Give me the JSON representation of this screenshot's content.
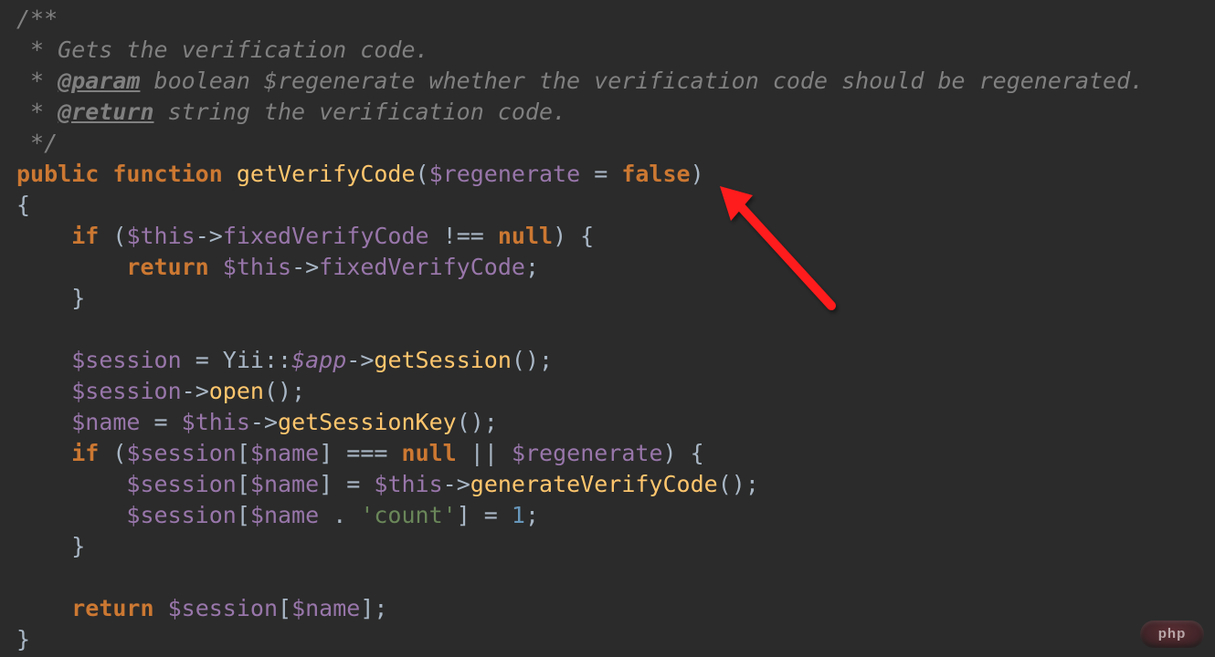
{
  "doc": {
    "open": "/**",
    "line1_prefix": " * ",
    "line1_text": "Gets the verification code.",
    "line2_prefix": " * ",
    "line2_tag": "@param",
    "line2_text": " boolean $regenerate whether the verification code should be regenerated.",
    "line3_prefix": " * ",
    "line3_tag": "@return",
    "line3_text": " string the verification code.",
    "close": " */"
  },
  "sig": {
    "kw_public": "public",
    "kw_function": "function",
    "name": "getVerifyCode",
    "paren_open": "(",
    "param": "$regenerate",
    "eq": " = ",
    "default": "false",
    "paren_close": ")"
  },
  "body": {
    "brace_open": "{",
    "if1": {
      "kw_if": "if",
      "po": " (",
      "this": "$this",
      "arrow": "->",
      "prop": "fixedVerifyCode",
      "neq": " !== ",
      "null": "null",
      "pc": ") {"
    },
    "ret1": {
      "kw_return": "return",
      "sp": " ",
      "this": "$this",
      "arrow": "->",
      "prop": "fixedVerifyCode",
      "semi": ";"
    },
    "close1": "}",
    "sess_assign": {
      "var": "$session",
      "eq": " = ",
      "cls": "Yii",
      "dcolon": "::",
      "static": "$app",
      "arrow": "->",
      "call": "getSession",
      "parens": "()",
      "semi": ";"
    },
    "sess_open": {
      "var": "$session",
      "arrow": "->",
      "call": "open",
      "parens": "()",
      "semi": ";"
    },
    "name_assign": {
      "var": "$name",
      "eq": " = ",
      "this": "$this",
      "arrow": "->",
      "call": "getSessionKey",
      "parens": "()",
      "semi": ";"
    },
    "if2": {
      "kw_if": "if",
      "po": " (",
      "sess": "$session",
      "br_o": "[",
      "nm": "$name",
      "br_c": "]",
      "eqeqeq": " === ",
      "null": "null",
      "oror": " || ",
      "regen": "$regenerate",
      "pc": ") {"
    },
    "gen": {
      "sess": "$session",
      "br_o": "[",
      "nm": "$name",
      "br_c": "]",
      "eq": " = ",
      "this": "$this",
      "arrow": "->",
      "call": "generateVerifyCode",
      "parens": "()",
      "semi": ";"
    },
    "count": {
      "sess": "$session",
      "br_o": "[",
      "nm": "$name",
      "dot": " . ",
      "str": "'count'",
      "br_c": "]",
      "eq": " = ",
      "one": "1",
      "semi": ";"
    },
    "close2": "}",
    "ret2": {
      "kw_return": "return",
      "sp": " ",
      "sess": "$session",
      "br_o": "[",
      "nm": "$name",
      "br_c": "]",
      "semi": ";"
    },
    "brace_close": "}"
  },
  "watermark": "php"
}
